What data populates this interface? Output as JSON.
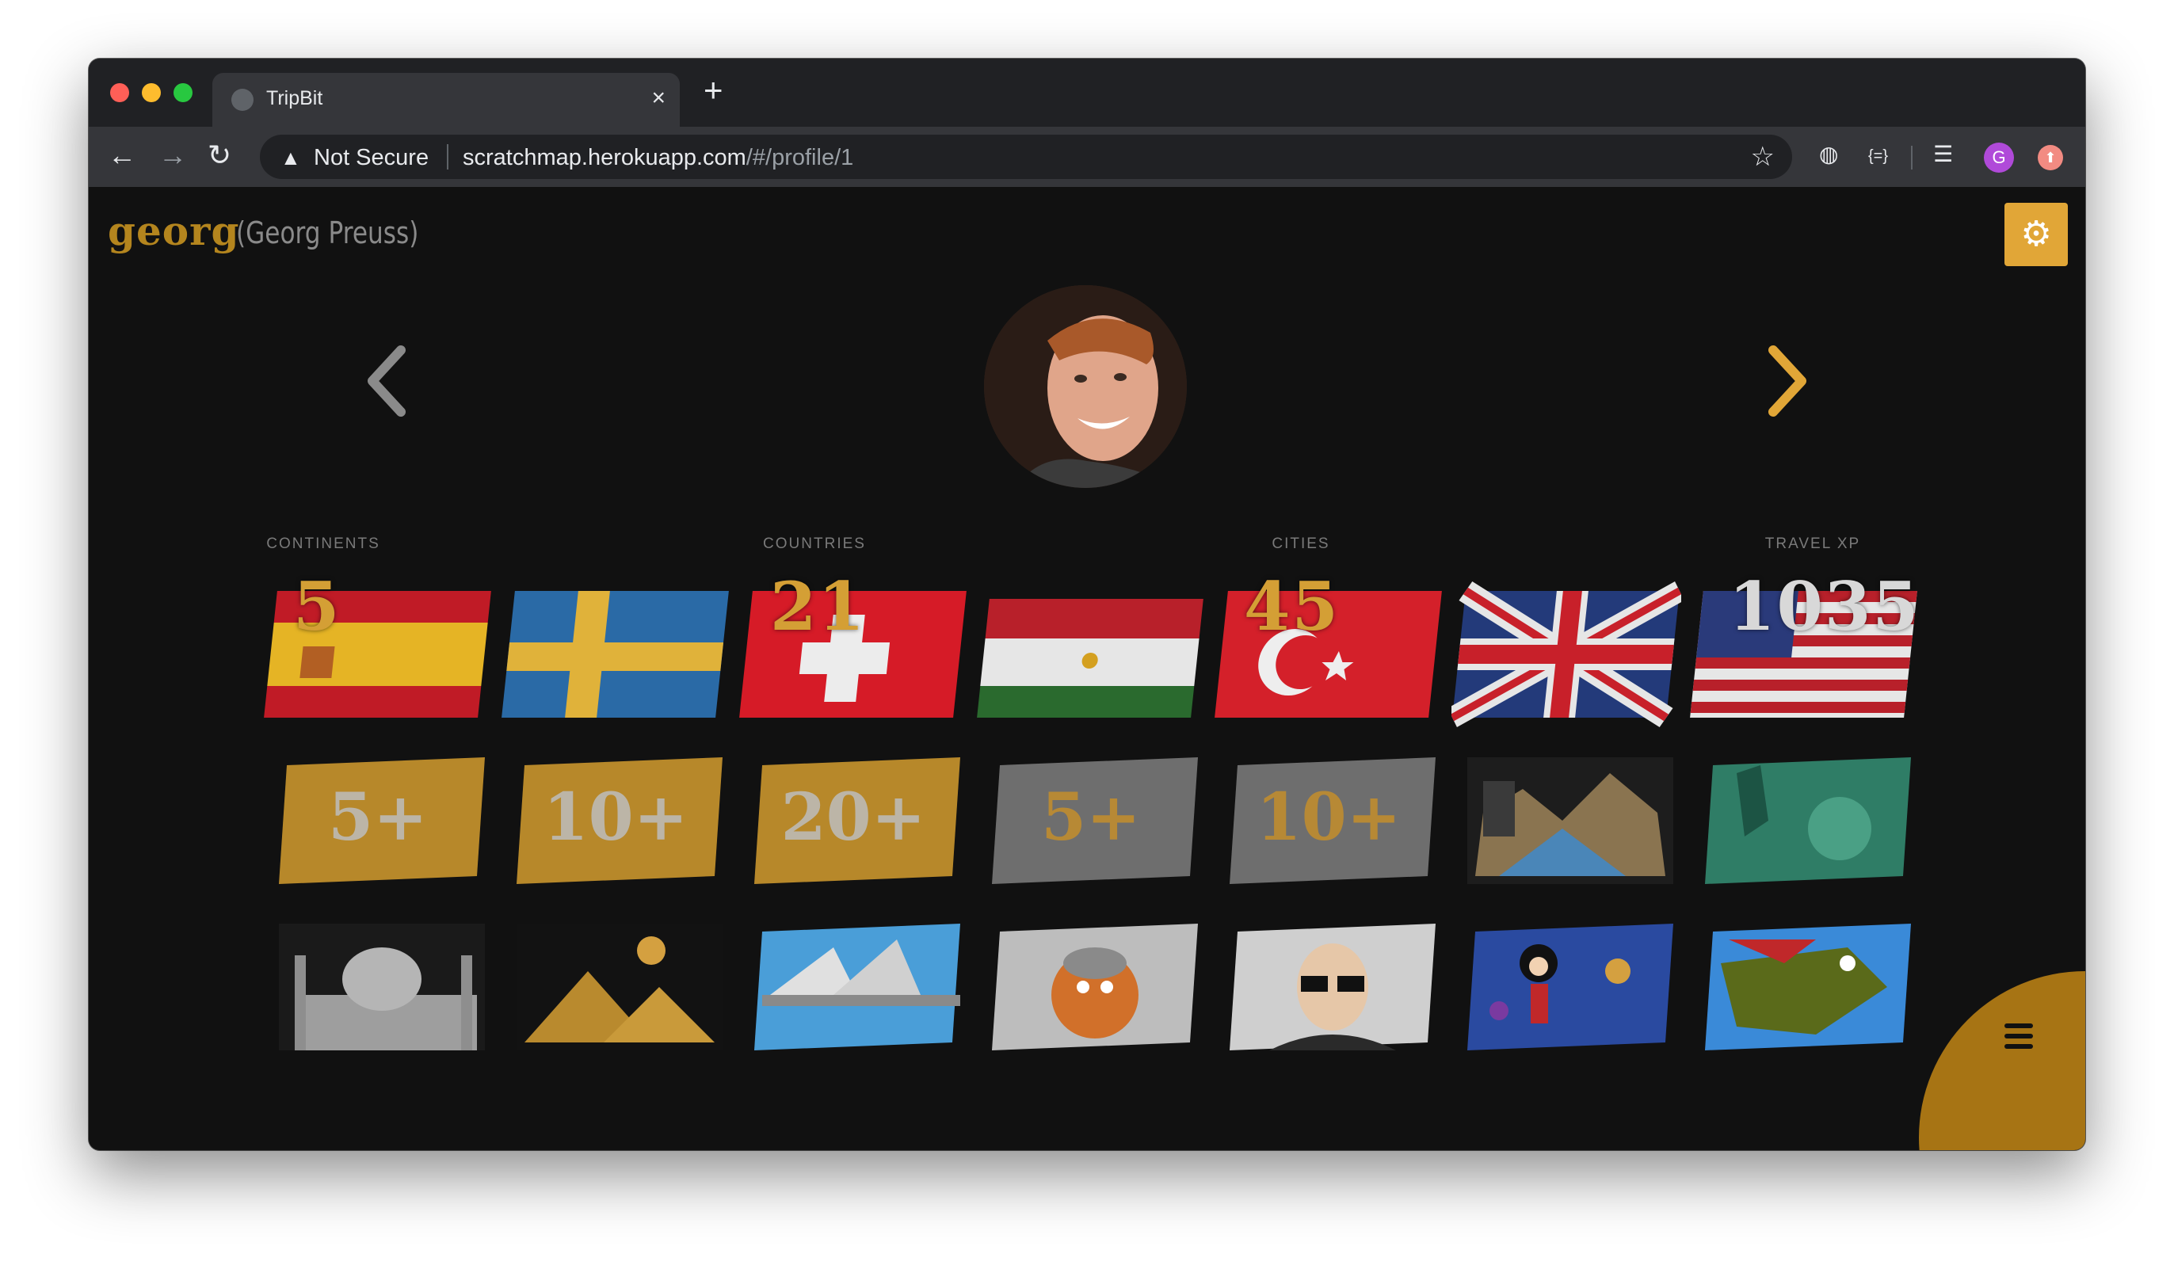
{
  "browser": {
    "tab_title": "TripBit",
    "tab_close": "×",
    "new_tab": "+",
    "back": "←",
    "forward": "→",
    "reload": "↻",
    "warning_glyph": "▲",
    "security_label": "Not Secure",
    "url_host": "scratchmap.herokuapp.com",
    "url_path": "/#/profile/1",
    "star": "☆",
    "ext_globe": "◍",
    "ext_code": "{=}",
    "ext_playlist": "☰",
    "profile_initial": "G",
    "ext_red": "⬆"
  },
  "profile": {
    "username": "georg",
    "full_name": "(Georg Preuss)",
    "settings_glyph": "⚙"
  },
  "stats": {
    "continents": {
      "label": "CONTINENTS",
      "value": "5"
    },
    "countries": {
      "label": "COUNTRIES",
      "value": "21"
    },
    "cities": {
      "label": "CITIES",
      "value": "45"
    },
    "travel_xp": {
      "label": "TRAVEL XP",
      "value": "1035"
    }
  },
  "flags": [
    "spain",
    "sweden",
    "switzerland",
    "tajikistan",
    "turkey",
    "united-kingdom",
    "united-states"
  ],
  "badges_row2": [
    "5+",
    "10+",
    "20+",
    "5+",
    "10+",
    "",
    ""
  ],
  "badges_row3": [
    "taj-mahal",
    "pyramids",
    "sydney-opera",
    "viking",
    "celebrity",
    "cartoon",
    "dinosaur"
  ],
  "colors": {
    "accent": "#e1a637",
    "gold": "#c48e2c",
    "background": "#111111"
  }
}
